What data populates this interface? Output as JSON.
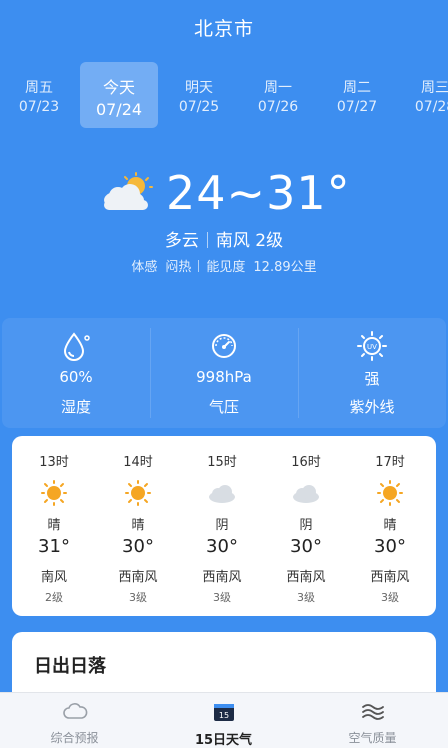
{
  "header": {
    "city": "北京市"
  },
  "days": [
    {
      "name": "周五",
      "date": "07/23",
      "active": false
    },
    {
      "name": "今天",
      "date": "07/24",
      "active": true
    },
    {
      "name": "明天",
      "date": "07/25",
      "active": false
    },
    {
      "name": "周一",
      "date": "07/26",
      "active": false
    },
    {
      "name": "周二",
      "date": "07/27",
      "active": false
    },
    {
      "name": "周三",
      "date": "07/28",
      "active": false
    }
  ],
  "current": {
    "icon": "partly-cloudy-icon",
    "temp_range": "24~31°",
    "condition": "多云",
    "wind": "南风 2级",
    "feels_label": "体感",
    "feels_value": "闷热",
    "visibility_label": "能见度",
    "visibility_value": "12.89公里"
  },
  "stats": [
    {
      "icon": "humidity-icon",
      "value": "60%",
      "label": "湿度"
    },
    {
      "icon": "pressure-gauge-icon",
      "value": "998hPa",
      "label": "气压"
    },
    {
      "icon": "uv-icon",
      "value": "强",
      "label": "紫外线"
    }
  ],
  "hourly": [
    {
      "time": "13时",
      "icon": "sun-icon",
      "cond": "晴",
      "temp": "31°",
      "wind": "南风",
      "level": "2级"
    },
    {
      "time": "14时",
      "icon": "sun-icon",
      "cond": "晴",
      "temp": "30°",
      "wind": "西南风",
      "level": "3级"
    },
    {
      "time": "15时",
      "icon": "cloud-icon",
      "cond": "阴",
      "temp": "30°",
      "wind": "西南风",
      "level": "3级"
    },
    {
      "time": "16时",
      "icon": "cloud-icon",
      "cond": "阴",
      "temp": "30°",
      "wind": "西南风",
      "level": "3级"
    },
    {
      "time": "17时",
      "icon": "sun-icon",
      "cond": "晴",
      "temp": "30°",
      "wind": "西南风",
      "level": "3级"
    }
  ],
  "sun_section": {
    "title": "日出日落"
  },
  "tabs": [
    {
      "label": "综合预报",
      "icon": "cloud-outline-icon",
      "active": false
    },
    {
      "label": "15日天气",
      "icon": "calendar-15-icon",
      "active": true
    },
    {
      "label": "空气质量",
      "icon": "wind-waves-icon",
      "active": false
    }
  ],
  "colors": {
    "background": "#3d8ef0",
    "sun": "#f5a623",
    "cloud": "#d8dde3"
  }
}
